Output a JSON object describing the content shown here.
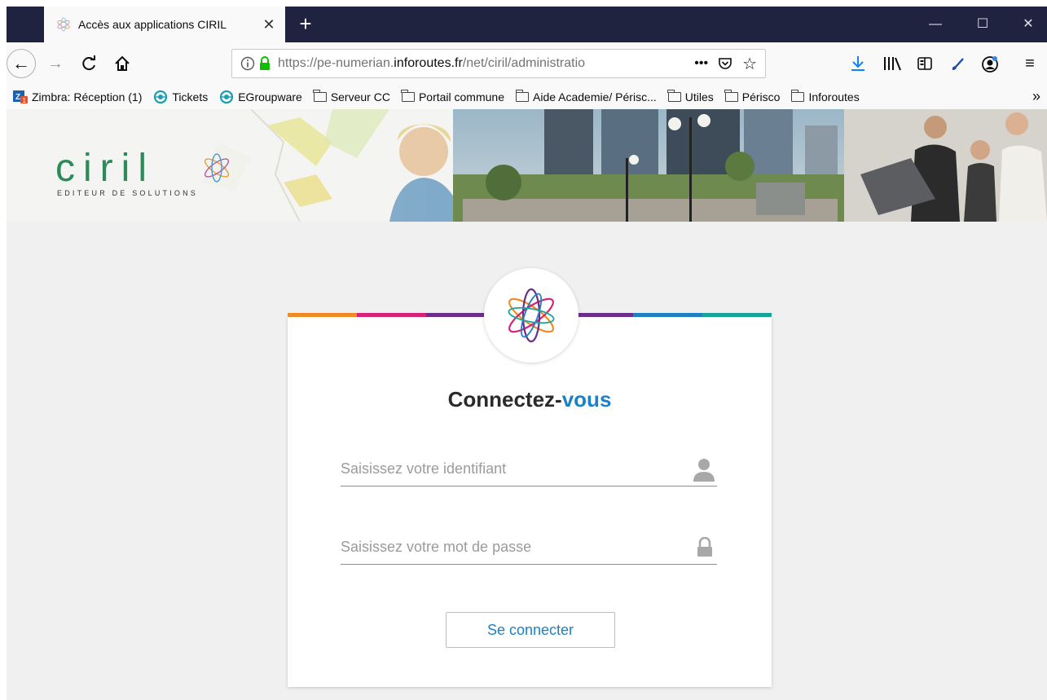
{
  "browser": {
    "tab_title": "Accès aux applications CIRIL",
    "url_prefix": "https://pe-numerian.",
    "url_host": "inforoutes.fr",
    "url_path": "/net/ciril/administratio",
    "url_more": "•••",
    "new_tab": "+",
    "bookmarks": [
      {
        "label": "Zimbra: Réception (1)",
        "icon": "zimbra-icon"
      },
      {
        "label": "Tickets",
        "icon": "groupware-icon"
      },
      {
        "label": "EGroupware",
        "icon": "groupware-icon"
      },
      {
        "label": "Serveur CC",
        "icon": "folder-icon"
      },
      {
        "label": "Portail commune",
        "icon": "folder-icon"
      },
      {
        "label": "Aide Academie/ Périsc...",
        "icon": "folder-icon"
      },
      {
        "label": "Utiles",
        "icon": "folder-icon"
      },
      {
        "label": "Périsco",
        "icon": "folder-icon"
      },
      {
        "label": "Inforoutes",
        "icon": "folder-icon"
      }
    ],
    "bookmarks_more": "»"
  },
  "banner": {
    "brand": "ciril",
    "tagline": "EDITEUR DE SOLUTIONS"
  },
  "login": {
    "heading_main": "Connectez-",
    "heading_accent": "vous",
    "username_placeholder": "Saisissez votre identifiant",
    "username_value": "",
    "password_placeholder": "Saisissez votre mot de passe",
    "password_value": "",
    "submit_label": "Se connecter"
  },
  "colors": {
    "accent_blue": "#1d7fc4",
    "colorbar": [
      "#f08a24",
      "#d6237a",
      "#6b2f8a",
      "#f5f5f5",
      "#6b2f8a",
      "#1d7fc4",
      "#17a59a"
    ],
    "brand_green": "#2d8a5a"
  }
}
